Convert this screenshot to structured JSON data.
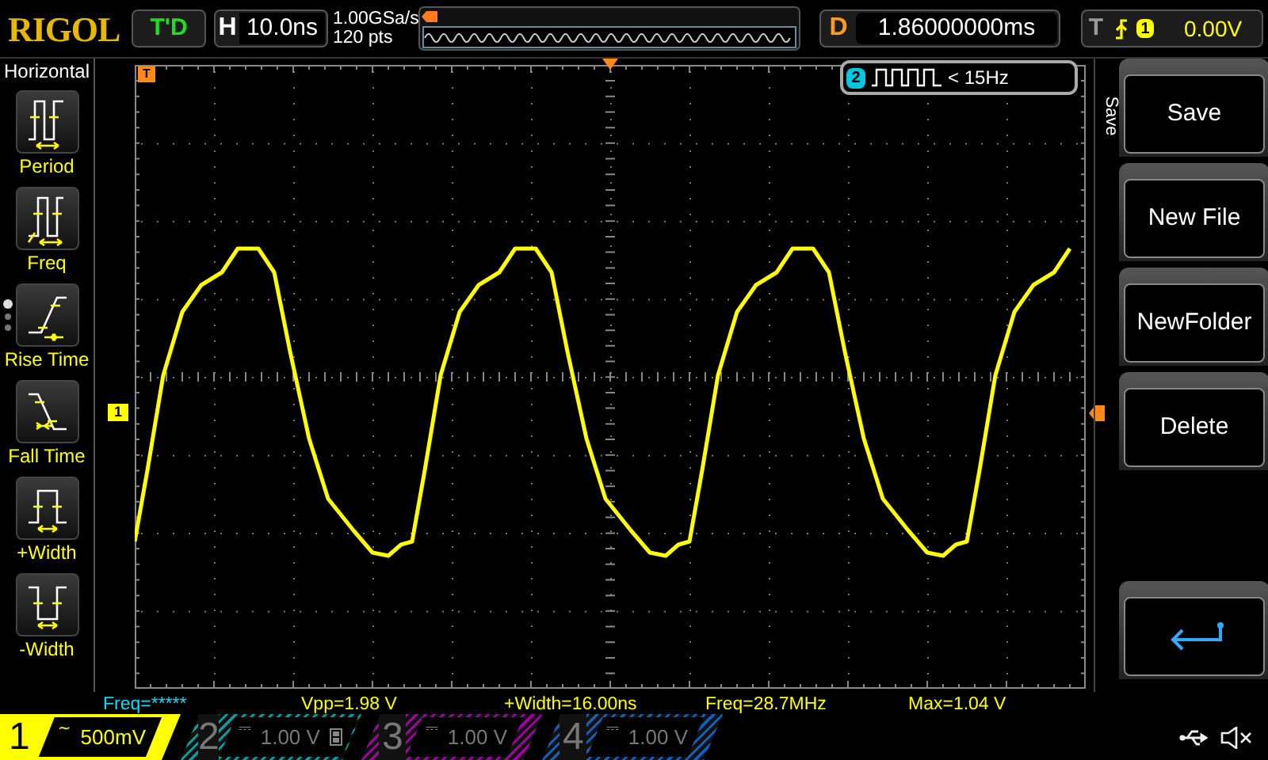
{
  "brand": "RIGOL",
  "run_status": "T'D",
  "horizontal": {
    "label": "H",
    "timebase": "10.0ns"
  },
  "sample_rate": "1.00GSa/s",
  "memory_depth": "120 pts",
  "delay": {
    "label": "D",
    "value": "1.86000000ms"
  },
  "trigger": {
    "label": "T",
    "channel": "1",
    "level": "0.00V"
  },
  "left_menu": {
    "title": "Horizontal",
    "items": [
      {
        "label": "Period",
        "kind": "period"
      },
      {
        "label": "Freq",
        "kind": "freq"
      },
      {
        "label": "Rise Time",
        "kind": "rise"
      },
      {
        "label": "Fall Time",
        "kind": "fall"
      },
      {
        "label": "+Width",
        "kind": "pwidth"
      },
      {
        "label": "-Width",
        "kind": "nwidth"
      }
    ],
    "pages": [
      {
        "selected": true
      },
      {
        "selected": false
      },
      {
        "selected": false
      }
    ]
  },
  "time_marker": "T",
  "channel_marker": "1",
  "freq_counter": {
    "channel": "2",
    "reading": "< 15Hz"
  },
  "measurements": [
    {
      "text": "Freq=*****",
      "color": "#00e0ff"
    },
    {
      "text": "Vpp=1.98 V",
      "color": "#ffff00"
    },
    {
      "text": "+Width=16.00ns",
      "color": "#ffff00"
    },
    {
      "text": "Freq=28.7MHz",
      "color": "#ffff00"
    },
    {
      "text": "Max=1.04 V",
      "color": "#ffff00"
    }
  ],
  "right_menu": {
    "title": "Save",
    "items": [
      {
        "kind": "text",
        "label": "Save"
      },
      {
        "kind": "text",
        "label": "New File"
      },
      {
        "kind": "text",
        "label": "NewFolder"
      },
      {
        "kind": "text",
        "label": "Delete"
      },
      {
        "kind": "back"
      }
    ]
  },
  "channels": [
    {
      "number": "1",
      "coupling": "~",
      "scale": "500mV",
      "on": true,
      "bw_limit": false,
      "color": "#ffff00"
    },
    {
      "number": "2",
      "coupling": "⎓",
      "scale": "1.00 V",
      "on": false,
      "bw_limit": true,
      "color": "#00a0a0"
    },
    {
      "number": "3",
      "coupling": "⎓",
      "scale": "1.00 V",
      "on": false,
      "bw_limit": false,
      "color": "#a000a0"
    },
    {
      "number": "4",
      "coupling": "⎓",
      "scale": "1.00 V",
      "on": false,
      "bw_limit": false,
      "color": "#1060c0"
    }
  ]
}
